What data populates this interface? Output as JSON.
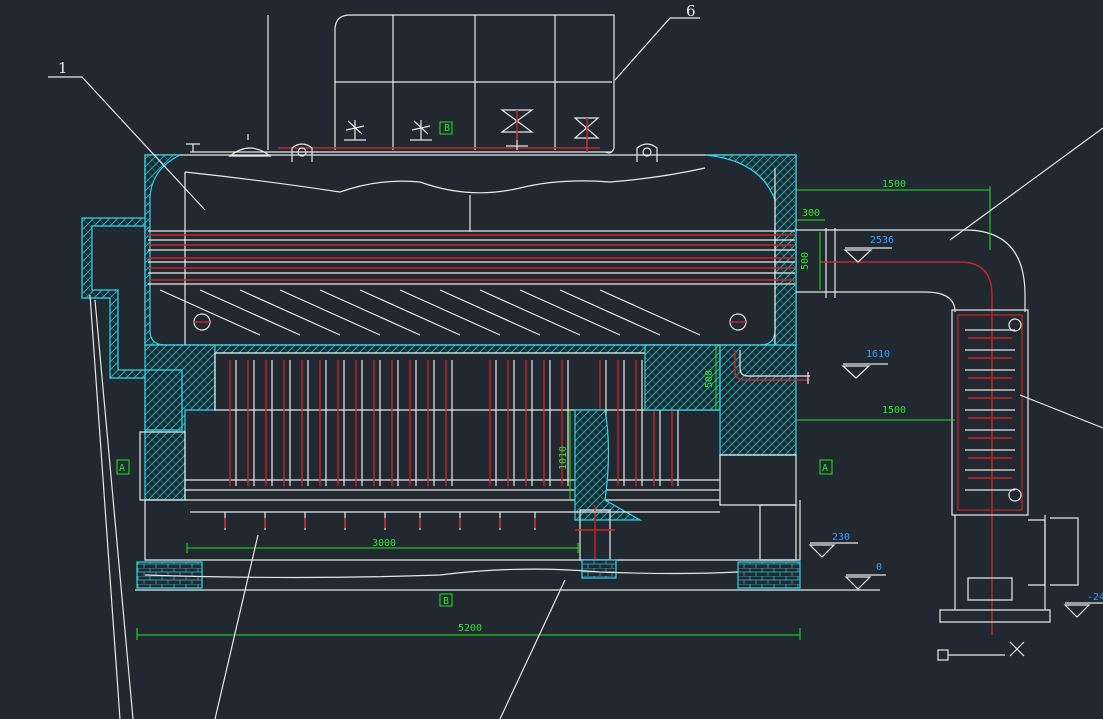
{
  "drawing": {
    "callouts": {
      "c1": "1",
      "c6": "6"
    },
    "dimensions": {
      "d1500_top": "1500",
      "d300": "300",
      "d500_right": "500",
      "d500_mid": "500",
      "d1500_mid": "1500",
      "d3000": "3000",
      "d5200": "5200",
      "d1010": "1010"
    },
    "elevations": {
      "e2536": "2536",
      "e1610": "1610",
      "e230": "230",
      "e0": "0",
      "e_neg": "-24"
    },
    "section_marks": {
      "a_left": "A",
      "a_right": "A",
      "b_top": "B",
      "b_bottom": "B"
    }
  }
}
